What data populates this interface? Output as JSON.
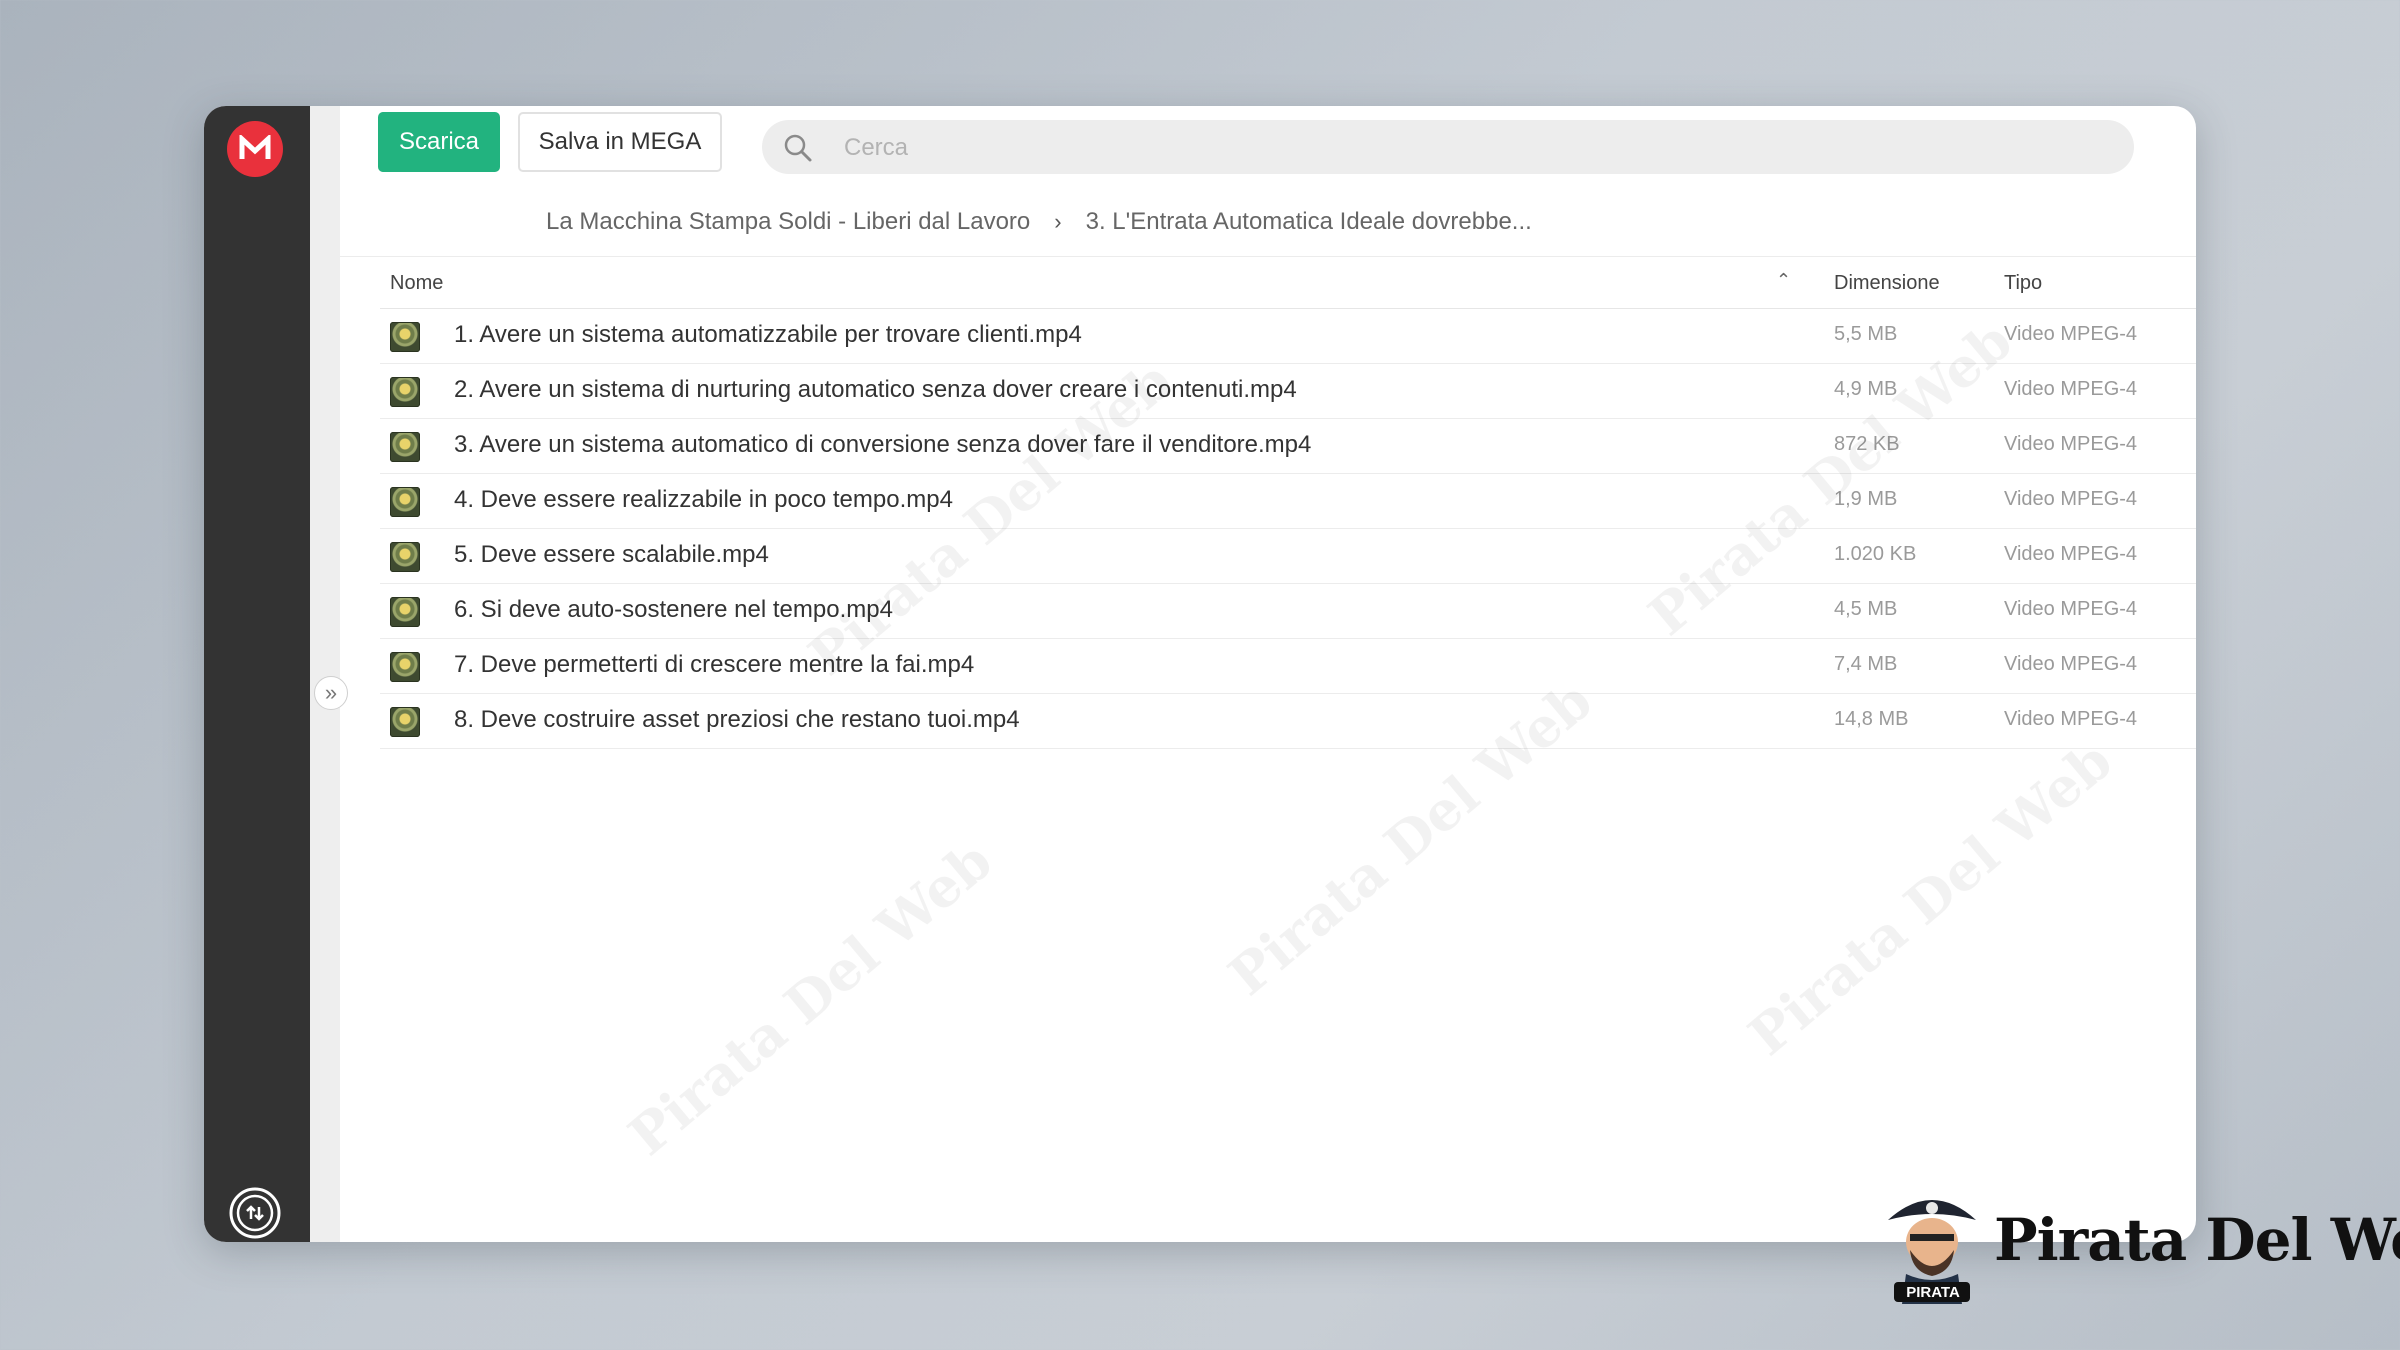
{
  "toolbar": {
    "download_label": "Scarica",
    "save_label": "Salva in MEGA"
  },
  "search": {
    "placeholder": "Cerca",
    "value": ""
  },
  "breadcrumb": {
    "items": [
      "La Macchina Stampa Soldi - Liberi dal Lavoro",
      "3. L'Entrata Automatica Ideale dovrebbe..."
    ],
    "separator": "›"
  },
  "table": {
    "columns": {
      "name": "Nome",
      "size": "Dimensione",
      "type": "Tipo"
    },
    "rows": [
      {
        "name": "1. Avere un sistema automatizzabile per trovare clienti.mp4",
        "size": "5,5 MB",
        "type": "Video MPEG-4"
      },
      {
        "name": "2. Avere un sistema di nurturing automatico senza dover creare i contenuti.mp4",
        "size": "4,9 MB",
        "type": "Video MPEG-4"
      },
      {
        "name": "3. Avere un sistema automatico di conversione senza dover fare il venditore.mp4",
        "size": "872 KB",
        "type": "Video MPEG-4"
      },
      {
        "name": "4. Deve essere realizzabile in poco tempo.mp4",
        "size": "1,9 MB",
        "type": "Video MPEG-4"
      },
      {
        "name": "5. Deve essere scalabile.mp4",
        "size": "1.020 KB",
        "type": "Video MPEG-4"
      },
      {
        "name": "6. Si deve auto-sostenere nel tempo.mp4",
        "size": "4,5 MB",
        "type": "Video MPEG-4"
      },
      {
        "name": "7. Deve permetterti di crescere mentre la fai.mp4",
        "size": "7,4 MB",
        "type": "Video MPEG-4"
      },
      {
        "name": "8. Deve costruire asset preziosi che restano tuoi.mp4",
        "size": "14,8 MB",
        "type": "Video MPEG-4"
      }
    ]
  },
  "watermark": {
    "text": "Pirata Del Web"
  },
  "brand": {
    "name": "Pirata Del Web",
    "badge": "PIRATA"
  },
  "colors": {
    "accent": "#22b37f",
    "mega_red": "#e9313c",
    "sidebar": "#333333"
  },
  "icons": {
    "logo": "mega-logo-icon",
    "search": "search-icon",
    "expand": "double-chevron-right-icon",
    "sort": "chevron-up-icon",
    "file": "video-thumbnail-icon",
    "transfers": "transfer-icon"
  }
}
